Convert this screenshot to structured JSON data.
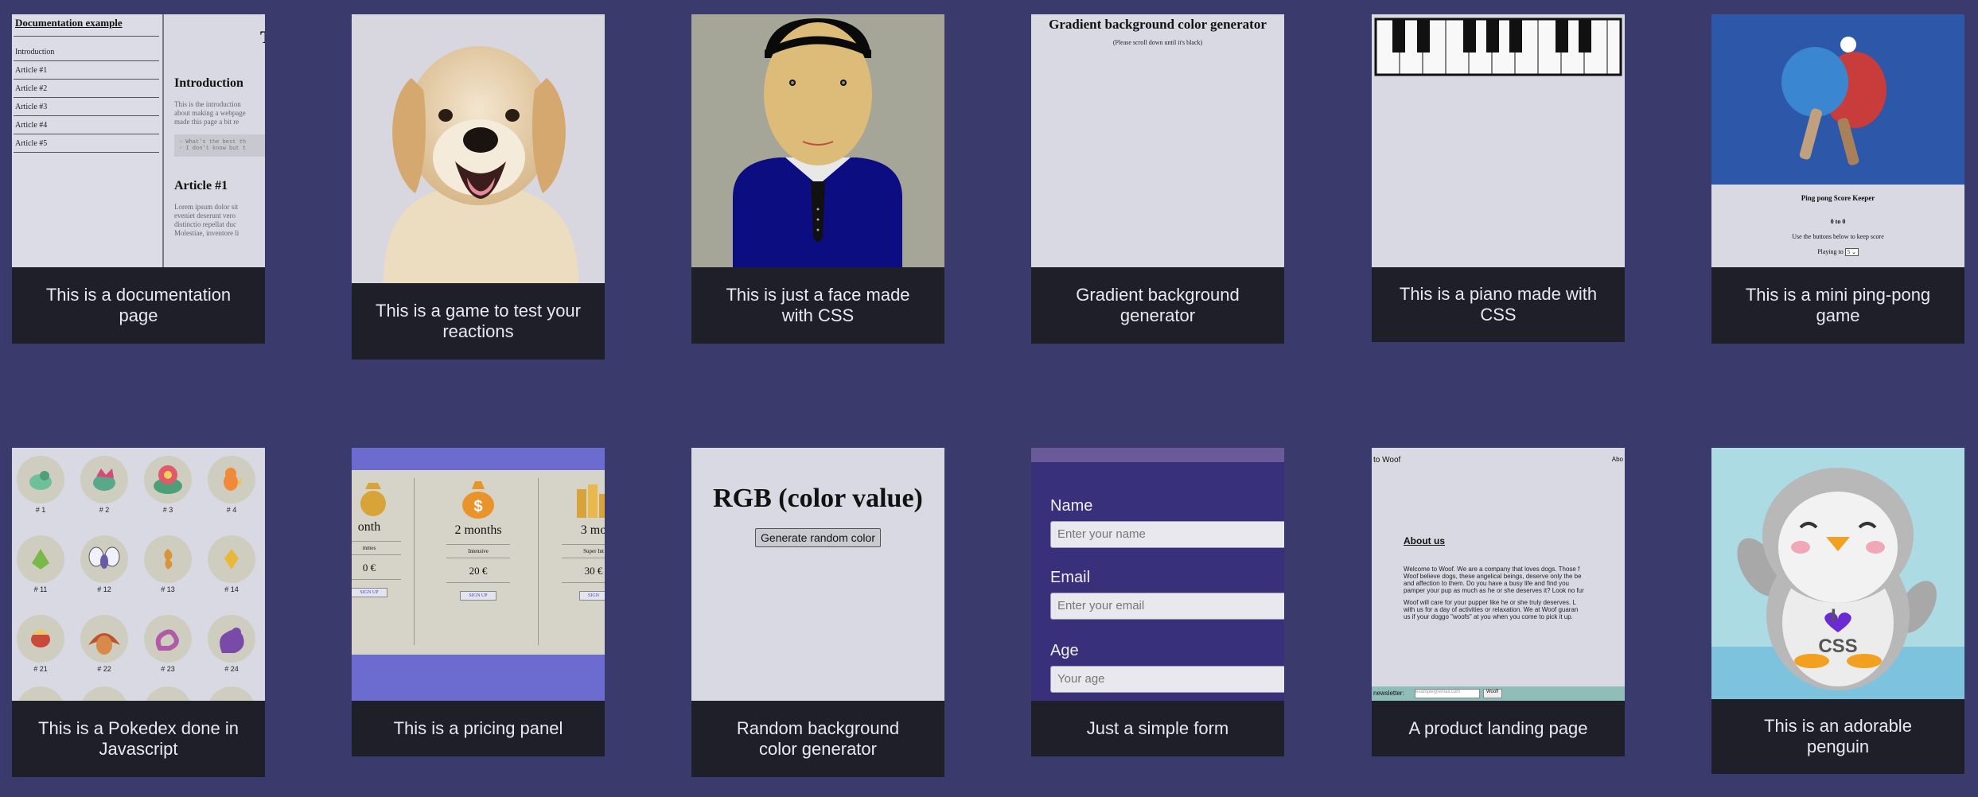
{
  "cards": [
    {
      "caption": "This is a documentation page"
    },
    {
      "caption": "This is a game to test your reactions"
    },
    {
      "caption": "This is just a face made with CSS"
    },
    {
      "caption": "Gradient background generator"
    },
    {
      "caption": "This is a piano made with CSS"
    },
    {
      "caption": "This is a mini ping-pong game"
    },
    {
      "caption": "This is a Pokedex done in Javascript"
    },
    {
      "caption": "This is a pricing panel"
    },
    {
      "caption": "Random background color generator"
    },
    {
      "caption": "Just a simple form"
    },
    {
      "caption": "A product landing page"
    },
    {
      "caption": "This is an adorable penguin"
    }
  ],
  "doc": {
    "nav_title": "Documentation example",
    "nav_links": [
      "Introduction",
      "Article #1",
      "Article #2",
      "Article #3",
      "Article #4",
      "Article #5"
    ],
    "corner_letter": "T",
    "h_intro": "Introduction",
    "intro_lines": [
      "This is the introduction",
      "about making a webpage",
      "made this page a bit re"
    ],
    "code_lines": [
      "- What's the best th",
      "- I don't know but t"
    ],
    "h_article1": "Article #1",
    "article_lines": [
      "Lorem ipsum dolor sit",
      "eveniet deserunt vero",
      "distinctio repellat duc",
      "Molestiae, inventore li"
    ]
  },
  "gradient": {
    "title": "Gradient background color generator",
    "subtitle": "(Please scroll down until it's black)"
  },
  "pingpong": {
    "title": "Ping pong Score Keeper",
    "score": "0 to 0",
    "instructions": "Use the buttons below to keep score",
    "playing_to_label": "Playing to",
    "playing_to_value": "5"
  },
  "pokedex": {
    "numbers": [
      "# 1",
      "# 2",
      "# 3",
      "# 4",
      "# 11",
      "# 12",
      "# 13",
      "# 14",
      "# 21",
      "# 22",
      "# 23",
      "# 24"
    ]
  },
  "pricing": {
    "columns": [
      {
        "name": "onth",
        "feature": "mmes",
        "price": "0 €",
        "button": "SIGN UP"
      },
      {
        "name": "2 months",
        "feature": "Intensive",
        "price": "20 €",
        "button": "SIGN UP"
      },
      {
        "name": "3 mo",
        "feature": "Super Int",
        "price": "30 €",
        "button": "SIGN"
      }
    ],
    "icon_symbol": "$"
  },
  "rgb": {
    "title": "RGB (color value)",
    "button": "Generate random color"
  },
  "form": {
    "name_label": "Name",
    "name_placeholder": "Enter your name",
    "email_label": "Email",
    "email_placeholder": "Enter your email",
    "age_label": "Age",
    "age_placeholder": "Your age"
  },
  "woof": {
    "top_left": "to Woof",
    "top_right": "Abo",
    "about": "About us",
    "para1": [
      "Welcome to Woof. We are a company that loves dogs. Those f",
      "Woof believe dogs, these angelical beings, deserve only the be",
      "and affection to them. Do you have a busy life and find you",
      "pamper your pup as much as he or she deserves it? Look no fur"
    ],
    "para2": [
      "Woof will care for your pupper like he or she truly deserves. L",
      "with us for a day of activities or relaxation. We at Woof guaran",
      "us if your doggo \"woofs\" at you when you come to pick it up."
    ],
    "newsletter_label": "newsletter:",
    "newsletter_placeholder": "example@email.com",
    "newsletter_button": "Woof!"
  },
  "penguin": {
    "line1": "I",
    "line2": "CSS"
  }
}
